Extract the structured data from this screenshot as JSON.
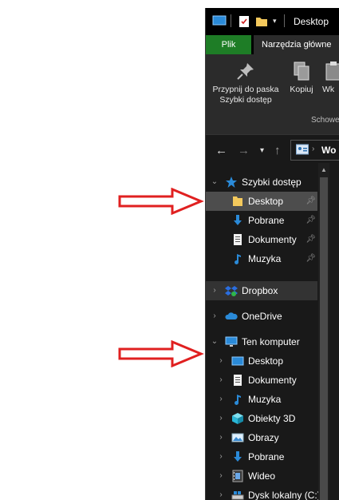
{
  "window": {
    "title": "Desktop"
  },
  "ribbon": {
    "tabs": [
      "Plik",
      "Narzędzia główne"
    ],
    "pin_label_line1": "Przypnij do paska",
    "pin_label_line2": "Szybki dostęp",
    "copy_label": "Kopiuj",
    "paste_label": "Wk",
    "group_label": "Schowek"
  },
  "address": {
    "path": "Wo"
  },
  "sidebar": {
    "items": [
      {
        "label": "Szybki dostęp",
        "icon": "star-icon"
      },
      {
        "label": "Desktop",
        "icon": "folder-icon",
        "pinned": true
      },
      {
        "label": "Pobrane",
        "icon": "download-icon",
        "pinned": true
      },
      {
        "label": "Dokumenty",
        "icon": "document-icon",
        "pinned": true
      },
      {
        "label": "Muzyka",
        "icon": "music-icon",
        "pinned": true
      },
      {
        "label": "Dropbox",
        "icon": "dropbox-icon"
      },
      {
        "label": "OneDrive",
        "icon": "cloud-icon"
      },
      {
        "label": "Ten komputer",
        "icon": "computer-icon"
      },
      {
        "label": "Desktop",
        "icon": "desktop-icon"
      },
      {
        "label": "Dokumenty",
        "icon": "document-icon"
      },
      {
        "label": "Muzyka",
        "icon": "music-icon"
      },
      {
        "label": "Obiekty 3D",
        "icon": "cube-icon"
      },
      {
        "label": "Obrazy",
        "icon": "picture-icon"
      },
      {
        "label": "Pobrane",
        "icon": "download-icon"
      },
      {
        "label": "Wideo",
        "icon": "video-icon"
      },
      {
        "label": "Dysk lokalny (C:)",
        "icon": "drive-icon"
      }
    ]
  },
  "colors": {
    "arrow": "#e02020",
    "plik_tab": "#1e7d26",
    "selection": "#4d4d4d",
    "accent_blue": "#2a8ad8"
  }
}
